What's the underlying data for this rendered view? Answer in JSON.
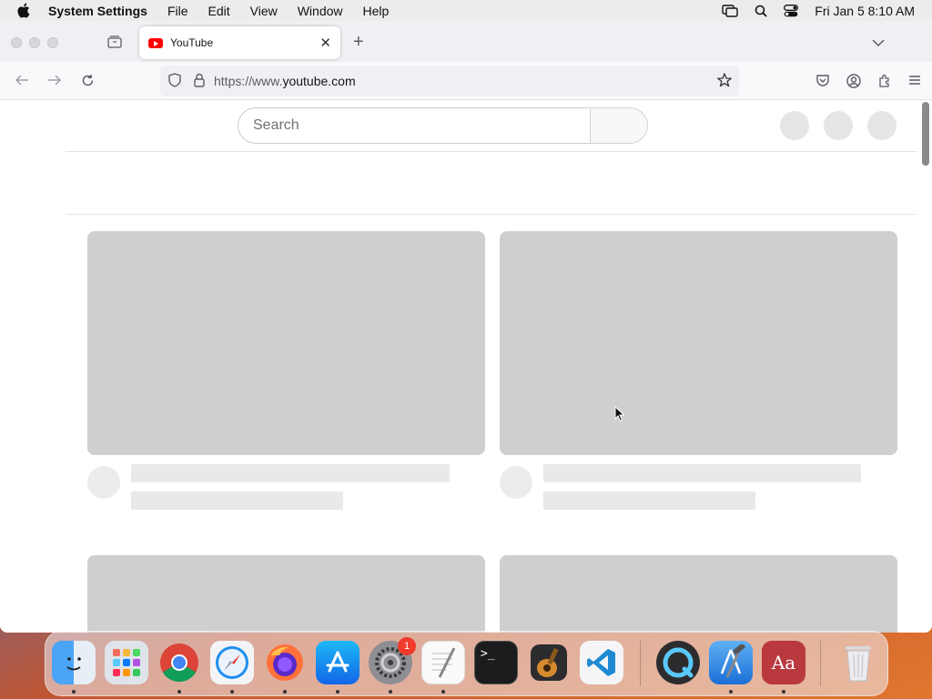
{
  "menubar": {
    "app_name": "System Settings",
    "menus": [
      "File",
      "Edit",
      "View",
      "Window",
      "Help"
    ],
    "datetime": "Fri Jan 5  8:10 AM"
  },
  "browser": {
    "tab_title": "YouTube",
    "url_prefix": "https://www.",
    "url_domain": "youtube.com"
  },
  "page": {
    "search_placeholder": "Search"
  },
  "dock": {
    "apps": [
      {
        "name": "Finder",
        "icon": "finder-icon"
      },
      {
        "name": "Launchpad",
        "icon": "launchpad-icon"
      },
      {
        "name": "Chrome",
        "icon": "chrome-icon"
      },
      {
        "name": "Safari",
        "icon": "safari-icon"
      },
      {
        "name": "Firefox",
        "icon": "firefox-icon"
      },
      {
        "name": "App Store",
        "icon": "app-store-icon"
      },
      {
        "name": "System Settings",
        "icon": "system-settings-icon",
        "badge": "1"
      },
      {
        "name": "TextEdit",
        "icon": "textedit-icon"
      },
      {
        "name": "Terminal",
        "icon": "terminal-icon"
      },
      {
        "name": "GarageBand",
        "icon": "garageband-icon"
      },
      {
        "name": "VS Code",
        "icon": "vscode-icon"
      },
      {
        "name": "QuickTime Player",
        "icon": "quicktime-icon"
      },
      {
        "name": "Xcode",
        "icon": "xcode-icon"
      },
      {
        "name": "Dictionary",
        "icon": "dictionary-icon"
      },
      {
        "name": "Trash",
        "icon": "trash-icon"
      }
    ],
    "dictionary_label": "Aa",
    "terminal_label": ">_"
  },
  "colors": {
    "youtube_red": "#ff0000",
    "skeleton": "#cfcfcf",
    "badge": "#f03a2e"
  }
}
